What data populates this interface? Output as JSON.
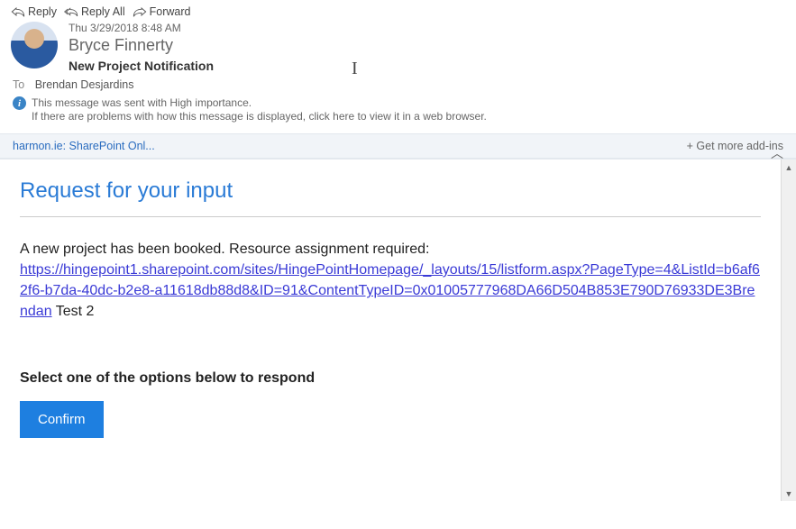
{
  "toolbar": {
    "reply": "Reply",
    "reply_all": "Reply All",
    "forward": "Forward"
  },
  "header": {
    "sent_date": "Thu 3/29/2018 8:48 AM",
    "sender": "Bryce Finnerty",
    "subject": "New Project Notification"
  },
  "to": {
    "label": "To",
    "recipient": "Brendan Desjardins"
  },
  "info": {
    "importance": "This message was sent with High importance.",
    "view_browser": "If there are problems with how this message is displayed, click here to view it in a web browser."
  },
  "addins": {
    "addin_label": "harmon.ie: SharePoint Onl...",
    "get_more": "+  Get more add-ins"
  },
  "body": {
    "heading": "Request for your input",
    "intro": "A new project has been booked. Resource assignment required:",
    "link": "https://hingepoint1.sharepoint.com/sites/HingePointHomepage/_layouts/15/listform.aspx?PageType=4&ListId=b6af62f6-b7da-40dc-b2e8-a11618db88d8&ID=91&ContentTypeID=0x01005777968DA66D504B853E790D76933DE3Brendan",
    "trailing": " Test 2",
    "respond_heading": "Select one of the options below to respond",
    "confirm_label": "Confirm"
  }
}
